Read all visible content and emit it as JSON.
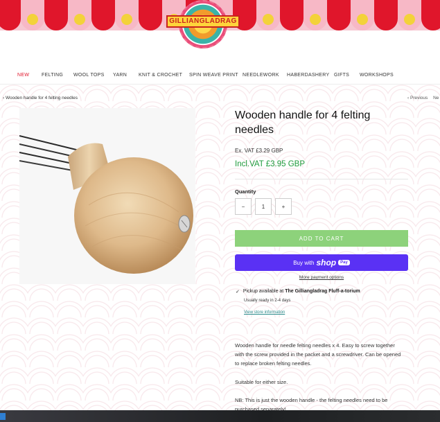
{
  "brand": {
    "logo_text": "GILLIANGLADRAG"
  },
  "nav": {
    "items": [
      "NEW",
      "FELTING",
      "WOOL TOPS",
      "YARN",
      "KNIT & CROCHET",
      "SPIN WEAVE PRINT",
      "NEEDLEWORK",
      "HABERDASHERY",
      "GIFTS",
      "WORKSHOPS"
    ]
  },
  "breadcrumb": {
    "text": "Wooden handle for 4 felting needles"
  },
  "pager": {
    "prev": "Previous",
    "next": "Ne"
  },
  "product": {
    "title": "Wooden handle for 4 felting needles",
    "ex_vat": "Ex. VAT  £3.29 GBP",
    "incl_vat": "Incl.VAT  £3.95 GBP",
    "quantity_label": "Quantity",
    "quantity_value": "1",
    "add_to_cart": "ADD TO CART",
    "buy_with": "Buy with",
    "shop_brand": "shop",
    "pay_badge": "Pay",
    "more_payment": "More payment options",
    "pickup_prefix": "Pickup available at",
    "pickup_store": "The Gilliangladrag Fluff-a-torium",
    "ready_text": "Usually ready in 2-4 days",
    "store_info": "View store information",
    "description": [
      "Wooden handle for needle felting needles x 4. Easy to screw together with the screw provided in the packet and a screwdriver. Can be opened to replace broken felting needles.",
      "Suitable for either size.",
      "NB: This is just the wooden handle - the felting needles need to be purchased separately!"
    ]
  },
  "colors": {
    "accent_red": "#e0162b",
    "price_green": "#1e9b3c",
    "cart_green": "#8dd27b",
    "shop_purple": "#5a31f4"
  }
}
